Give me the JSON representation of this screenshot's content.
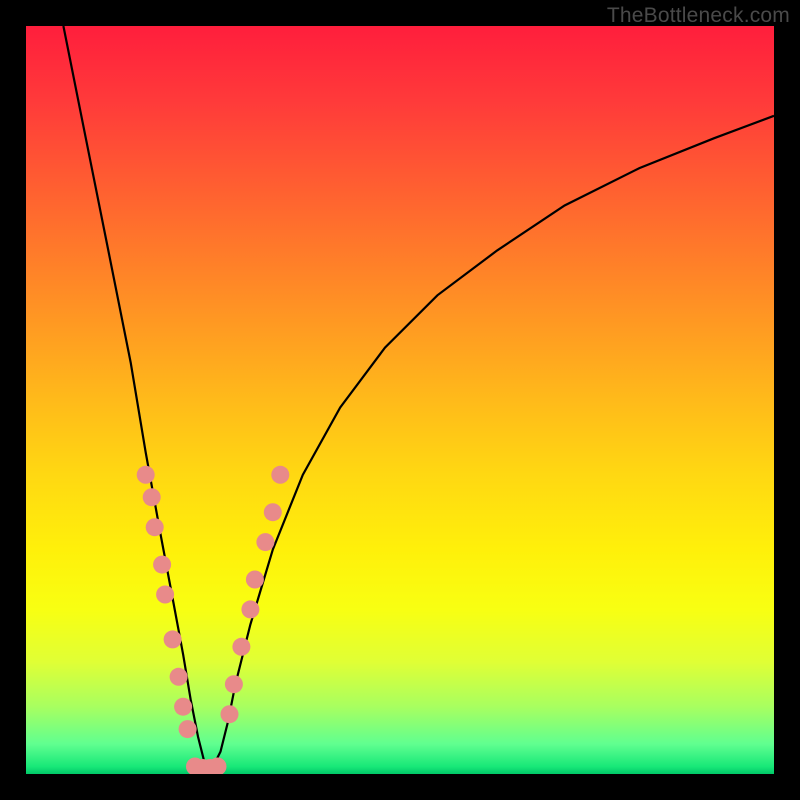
{
  "watermark": "TheBottleneck.com",
  "chart_data": {
    "type": "line",
    "title": "",
    "xlabel": "",
    "ylabel": "",
    "xlim": [
      0,
      100
    ],
    "ylim": [
      0,
      100
    ],
    "background_gradient": {
      "top_color": "#ff1e3c",
      "bottom_color": "#00c868",
      "description": "vertical gradient from red (high bottleneck) at top to green (low bottleneck) at bottom"
    },
    "series": [
      {
        "name": "bottleneck-curve",
        "description": "V-shaped curve; minimum near x≈24 where bottleneck is ~0",
        "x": [
          5,
          8,
          11,
          14,
          16,
          18,
          19.5,
          21,
          22,
          23,
          24,
          25,
          26,
          27,
          28,
          30,
          33,
          37,
          42,
          48,
          55,
          63,
          72,
          82,
          92,
          100
        ],
        "y": [
          100,
          85,
          70,
          55,
          43,
          32,
          24,
          16,
          10,
          5,
          1,
          1,
          3,
          7,
          12,
          20,
          30,
          40,
          49,
          57,
          64,
          70,
          76,
          81,
          85,
          88
        ]
      }
    ],
    "scatter_points": {
      "name": "highlighted-range",
      "color": "#e88a8a",
      "left_arm": {
        "x": [
          16.0,
          16.8,
          17.2,
          18.2,
          18.6,
          19.6,
          20.4,
          21.0,
          21.6
        ],
        "y": [
          40,
          37,
          33,
          28,
          24,
          18,
          13,
          9,
          6
        ]
      },
      "valley": {
        "x": [
          22.6,
          23.6,
          24.6,
          25.6
        ],
        "y": [
          1.0,
          0.8,
          0.8,
          1.0
        ]
      },
      "right_arm": {
        "x": [
          27.2,
          27.8,
          28.8,
          30.0,
          30.6,
          32.0,
          33.0,
          34.0
        ],
        "y": [
          8,
          12,
          17,
          22,
          26,
          31,
          35,
          40
        ]
      }
    }
  }
}
